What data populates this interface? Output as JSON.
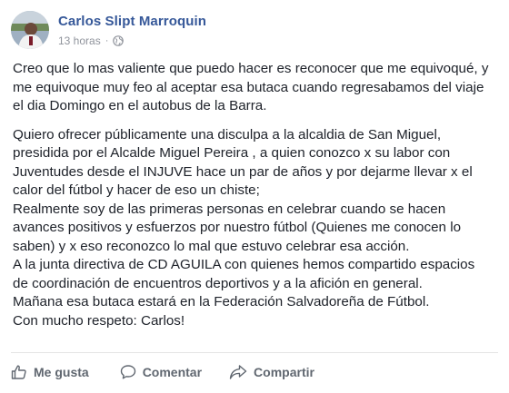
{
  "post": {
    "author": "Carlos Slipt Marroquin",
    "time": "13 horas",
    "separator": "·",
    "privacy_icon": "globe-icon",
    "paragraphs": [
      "Creo que lo mas valiente que puedo hacer es reconocer que me equivoqué, y\nme equivoque muy feo al aceptar esa butaca cuando regresabamos del viaje\nel dia Domingo en el autobus de la Barra.",
      "Quiero ofrecer públicamente una disculpa a la alcaldia de San Miguel,\npresidida por el Alcalde Miguel Pereira , a quien conozco x su labor con\nJuventudes desde el INJUVE hace un par de años y por dejarme llevar x el\ncalor del fútbol y hacer de eso un chiste;\nRealmente soy de las primeras personas en celebrar cuando se hacen\navances positivos y esfuerzos por nuestro fútbol (Quienes me conocen lo\nsaben) y x eso reconozco lo mal que estuvo celebrar esa acción.\nA la junta directiva de CD AGUILA con quienes hemos compartido espacios\nde coordinación de encuentros deportivos y a la afición en general.\nMañana esa butaca estará en la Federación Salvadoreña de Fútbol.\nCon mucho respeto: Carlos!"
    ]
  },
  "actions": {
    "like": {
      "label": "Me gusta",
      "icon": "thumbs-up-icon"
    },
    "comment": {
      "label": "Comentar",
      "icon": "comment-icon"
    },
    "share": {
      "label": "Compartir",
      "icon": "share-icon"
    }
  },
  "colors": {
    "author": "#365899",
    "meta": "#90949c",
    "action": "#606770",
    "text": "#1d2129"
  }
}
